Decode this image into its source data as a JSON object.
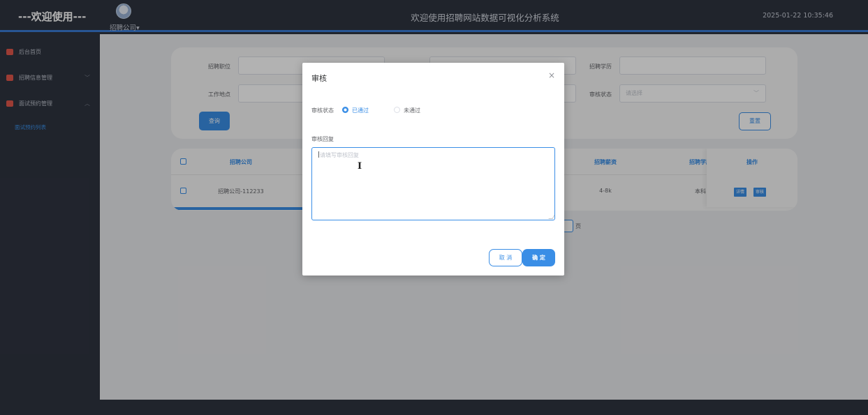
{
  "header": {
    "welcome": "---欢迎使用---",
    "company_menu": "招聘公司▾",
    "system_title": "欢迎使用招聘网站数据可视化分析系统",
    "datetime": "2025-01-22 10:35:46"
  },
  "sidebar": {
    "items": [
      {
        "label": "后台首页",
        "arrow": ""
      },
      {
        "label": "招聘信息管理",
        "arrow": "﹀"
      },
      {
        "label": "面试预约管理",
        "arrow": "︿"
      }
    ],
    "sub_items": [
      {
        "label": "面试预约列表"
      }
    ]
  },
  "search": {
    "position_label": "招聘职位",
    "education_label": "招聘学历",
    "location_label": "工作地点",
    "status_label": "审核状态",
    "status_placeholder": "请选择",
    "query_button": "查询",
    "reset_button": "重置"
  },
  "table": {
    "columns": {
      "company": "招聘公司",
      "salary": "招聘薪资",
      "education": "招聘学历",
      "actions": "操作"
    },
    "rows": [
      {
        "company": "招聘公司-112233",
        "salary": "4-8k",
        "education": "本科",
        "detail_button": "详情",
        "audit_button": "审核"
      }
    ]
  },
  "pagination": {
    "page_unit": "页"
  },
  "modal": {
    "title": "审核",
    "close": "×",
    "status_label": "审核状态",
    "status_options": [
      "已通过",
      "未通过"
    ],
    "selected_status": "已通过",
    "reply_label": "审核回复",
    "reply_placeholder": "请填写审核回复",
    "reply_value": "",
    "cancel_button": "取 消",
    "confirm_button": "确 定"
  },
  "colors": {
    "accent": "#3a8ee6",
    "sidebar_bg": "#2f3440",
    "menu_icon": "#e0564b"
  }
}
